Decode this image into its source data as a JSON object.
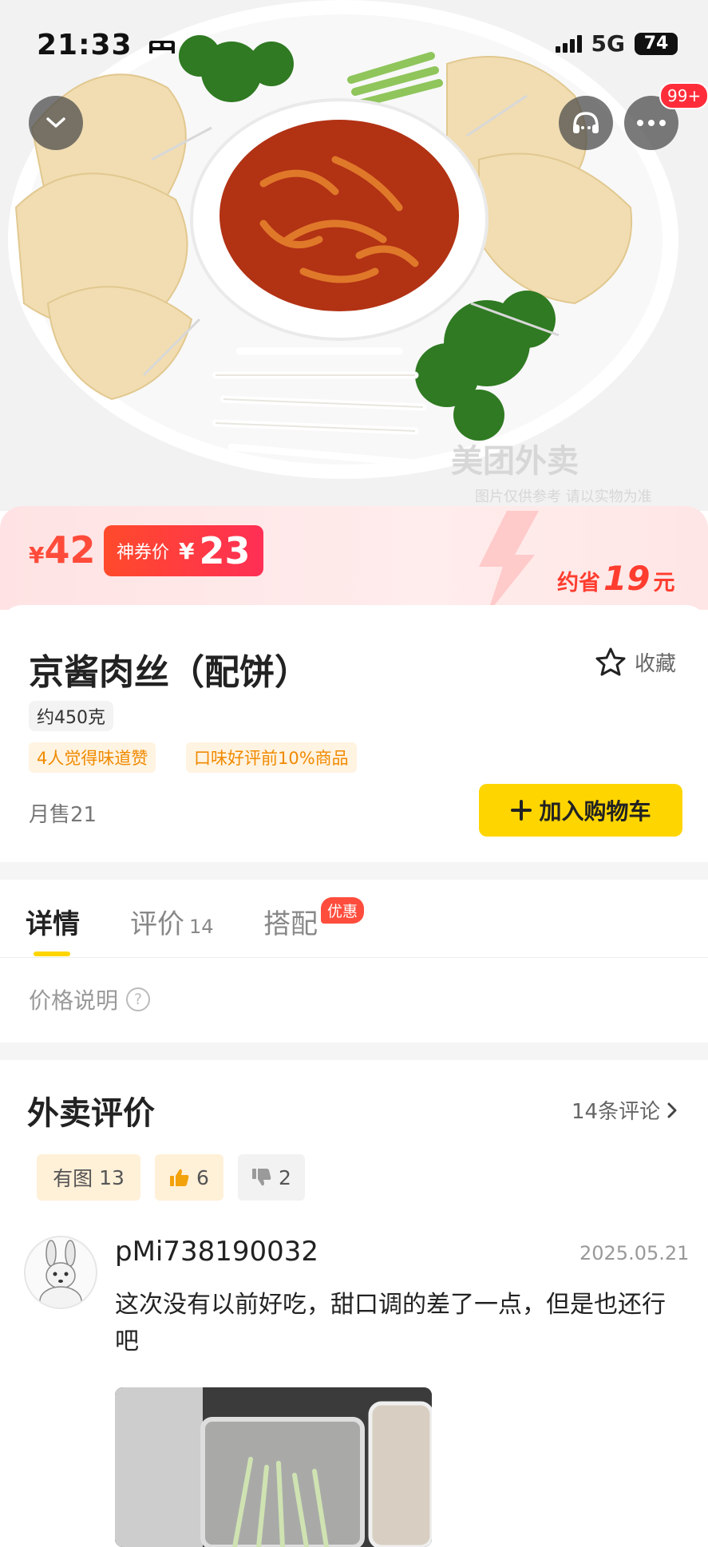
{
  "status_bar": {
    "time": "21:33",
    "network": "5G",
    "battery": "74"
  },
  "header": {
    "badge": "99+"
  },
  "hero_watermark": {
    "brand": "美团外卖",
    "note": "图片仅供参考 请以实物为准"
  },
  "price": {
    "currency": "¥",
    "original": "42",
    "coupon_label": "神券价",
    "coupon_price": "23",
    "save_prefix": "约省",
    "save_amount": "19",
    "save_suffix": "元"
  },
  "product": {
    "title": "京酱肉丝（配饼）",
    "favorite_label": "收藏",
    "weight": "约450克",
    "tags": [
      "4人觉得味道赞",
      "口味好评前10%商品"
    ],
    "monthly_sales": "月售21",
    "add_to_cart": "加入购物车"
  },
  "tabs": [
    {
      "label": "详情"
    },
    {
      "label": "评价",
      "count": "14"
    },
    {
      "label": "搭配",
      "badge": "优惠"
    }
  ],
  "price_note": "价格说明",
  "reviews": {
    "title": "外卖评价",
    "count_label": "14条评论",
    "filters": [
      {
        "label": "有图",
        "count": "13"
      },
      {
        "label": "",
        "count": "6"
      },
      {
        "label": "",
        "count": "2"
      }
    ],
    "items": [
      {
        "user": "pMi738190032",
        "date": "2025.05.21",
        "text": "这次没有以前好吃，甜口调的差了一点，但是也还行吧"
      }
    ]
  },
  "colors": {
    "accent_yellow": "#ffd500",
    "price_red": "#ff4b3a",
    "tag_orange": "#f08a00"
  }
}
